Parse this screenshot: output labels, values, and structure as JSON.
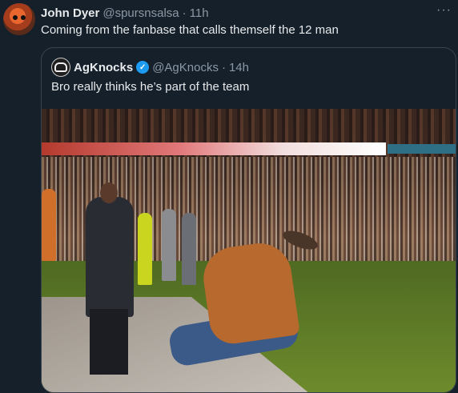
{
  "tweet": {
    "author_name": "John Dyer",
    "author_handle": "@spursnsalsa",
    "separator": "·",
    "time": "11h",
    "text": "Coming from the fanbase that calls themself the 12 man",
    "more_icon": "more-horizontal-icon"
  },
  "quoted": {
    "author_name": "AgKnocks",
    "author_handle": "@AgKnocks",
    "separator": "·",
    "time": "14h",
    "verified_icon": "verified-badge-icon",
    "text": "Bro really thinks he’s part of the team"
  },
  "colors": {
    "background": "#15202b",
    "text": "#e7e9ea",
    "muted": "#8b98a5",
    "border": "#38444d",
    "verified": "#1d9bf0"
  }
}
